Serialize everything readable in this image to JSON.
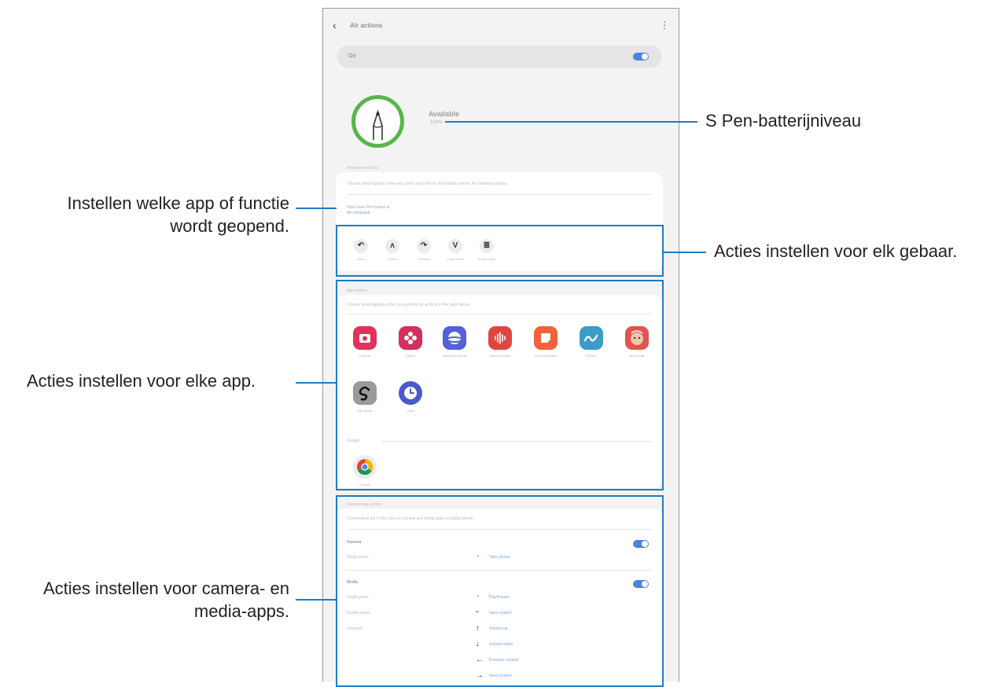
{
  "screen": {
    "title": "Air actions",
    "back_icon": "back-arrow-icon",
    "more_icon": "more-vert-icon",
    "master_toggle": {
      "label": "On",
      "state": "on"
    },
    "pen_status": {
      "status": "Available",
      "battery_text": "100%"
    },
    "anywhere_actions": {
      "section_label": "Anywhere actions",
      "description": "Choose what happens when you press and hold the Pen button and do the following actions.",
      "press_hold_label": "Hold down Pen button to",
      "press_hold_value": "Air command",
      "gestures": [
        {
          "icon": "back-gesture-icon",
          "glyph": "↶",
          "label": "Back"
        },
        {
          "icon": "home-gesture-icon",
          "glyph": "ʌ",
          "label": "Home"
        },
        {
          "icon": "recents-gesture-icon",
          "glyph": "↷",
          "label": "Recents"
        },
        {
          "icon": "smart-select-gesture-icon",
          "glyph": "V",
          "label": "Smart select"
        },
        {
          "icon": "screen-write-gesture-icon",
          "glyph": "≣",
          "label": "Screen write"
        }
      ]
    },
    "app_actions": {
      "section_label": "App actions",
      "description": "Choose what happens when you perform air actions in the apps below.",
      "apps": [
        {
          "icon": "camera-app-icon",
          "label": "Camera",
          "color": "#e0325a"
        },
        {
          "icon": "gallery-app-icon",
          "label": "Gallery",
          "color": "#d4305d"
        },
        {
          "icon": "internet-app-icon",
          "label": "Samsung Internet",
          "color": "#5560d9"
        },
        {
          "icon": "voice-recorder-app-icon",
          "label": "Voice Recorder",
          "color": "#e0453f"
        },
        {
          "icon": "samsung-notes-app-icon",
          "label": "Samsung Notes",
          "color": "#f0623a"
        },
        {
          "icon": "pennup-app-icon",
          "label": "PENUP",
          "color": "#3b9cc9"
        },
        {
          "icon": "ar-doodle-app-icon",
          "label": "AR Doodle",
          "color": "#e0554f"
        },
        {
          "icon": "clip-studio-app-icon",
          "label": "Clip Studio",
          "color": "#9a9a9a"
        },
        {
          "icon": "clock-app-icon",
          "label": "Clock",
          "color": "#4a5ac9"
        }
      ],
      "group_label": "Google",
      "extra_apps": [
        {
          "icon": "chrome-app-icon",
          "label": "Chrome"
        }
      ]
    },
    "general_app_actions": {
      "section_label": "General app actions",
      "description": "Control what the S Pen does in camera and media apps not listed above.",
      "camera": {
        "label": "Camera",
        "state": "on",
        "rows": [
          {
            "action": "Single press",
            "symbol": "•",
            "value": "Take picture"
          }
        ]
      },
      "media": {
        "label": "Media",
        "state": "on",
        "rows": [
          {
            "action": "Single press",
            "symbol": "•",
            "value": "Play/Pause"
          },
          {
            "action": "Double press",
            "symbol": "••",
            "value": "Next content"
          },
          {
            "action": "Gestures",
            "symbol": "↑",
            "value": "Volume up"
          },
          {
            "action": "",
            "symbol": "↓",
            "value": "Volume down"
          },
          {
            "action": "",
            "symbol": "←",
            "value": "Previous content"
          },
          {
            "action": "",
            "symbol": "→",
            "value": "Next content"
          }
        ]
      }
    }
  },
  "callouts": {
    "battery": "S Pen-batterijniveau",
    "press_hold_line1": "Instellen welke app of functie",
    "press_hold_line2": "wordt geopend.",
    "gestures": "Acties instellen voor elk gebaar.",
    "apps": "Acties instellen voor elke app.",
    "media_line1": "Acties instellen voor camera- en",
    "media_line2": "media-apps."
  },
  "colors": {
    "highlight": "#1d7cc4",
    "toggle_on": "#4b84e0",
    "pen_ring": "#5ab54a",
    "link_blue": "#7ca3e0"
  }
}
